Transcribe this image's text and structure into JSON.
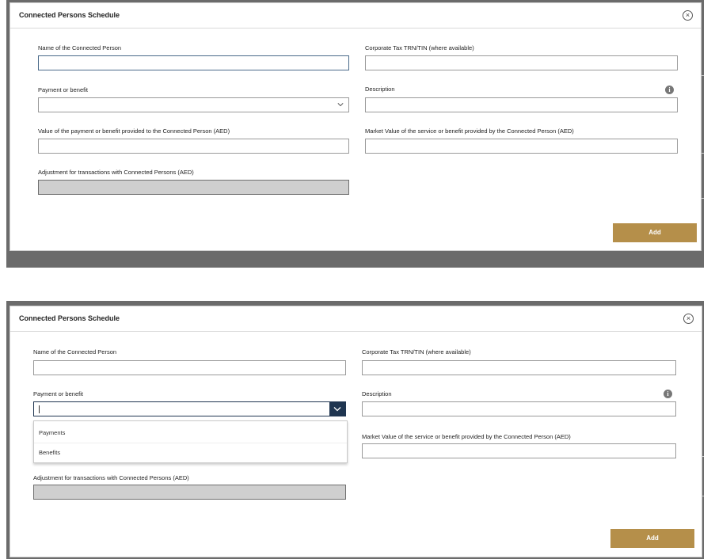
{
  "modal": {
    "title": "Connected Persons Schedule",
    "close_symbol": "×",
    "add_label": "Add"
  },
  "fields": {
    "name_label": "Name of the Connected Person",
    "name_value": "",
    "trn_label": "Corporate Tax TRN/TIN (where available)",
    "trn_value": "",
    "payment_label": "Payment or benefit",
    "payment_value": "",
    "description_label": "Description",
    "description_value": "",
    "value_paid_label": "Value of the payment or benefit provided to the Connected Person (AED)",
    "value_paid_value": "",
    "market_value_label": "Market Value of the service or benefit provided by the Connected Person (AED)",
    "market_value_value": "",
    "adjustment_label": "Adjustment for transactions with Connected Persons (AED)",
    "adjustment_value": ""
  },
  "dropdown": {
    "options": [
      "Payments",
      "Benefits"
    ]
  },
  "icons": {
    "close": "close-icon",
    "info": "info-icon",
    "chevron": "chevron-down-icon",
    "info_symbol": "i"
  },
  "colors": {
    "accent": "#b58f4a",
    "dropdown_button": "#1f3550",
    "disabled_field": "#cfcfcf"
  }
}
